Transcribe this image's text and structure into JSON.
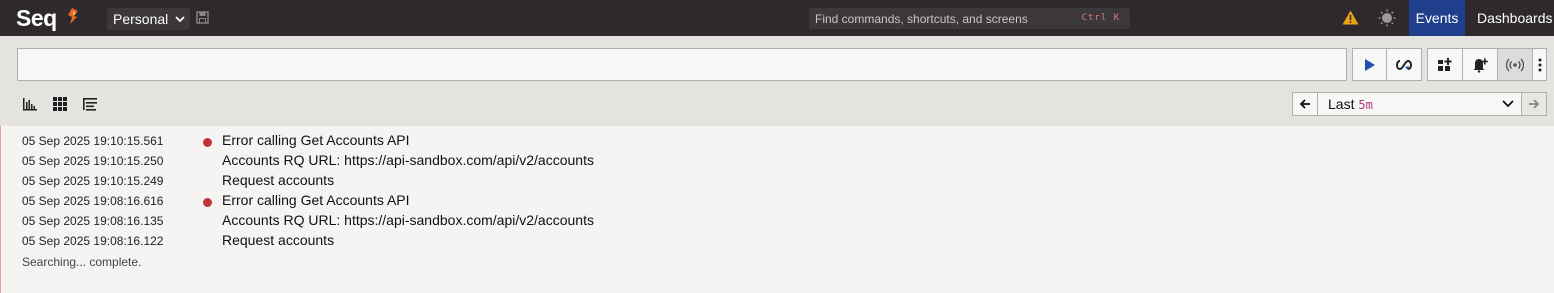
{
  "app": {
    "logo_text": "Seq",
    "workspace": "Personal",
    "command_placeholder": "Find commands, shortcuts, and screens",
    "command_shortcut": "Ctrl K"
  },
  "nav": {
    "events": "Events",
    "dashboards": "Dashboards"
  },
  "search": {
    "query": "",
    "time_range_label": "Last",
    "time_range_value": "5m"
  },
  "events": [
    {
      "timestamp": "05 Sep 2025  19:10:15.561",
      "level": "error",
      "message": "Error calling Get Accounts API"
    },
    {
      "timestamp": "05 Sep 2025  19:10:15.250",
      "level": "info",
      "message": "Accounts RQ URL: https://api-sandbox.com/api/v2/accounts"
    },
    {
      "timestamp": "05 Sep 2025  19:10:15.249",
      "level": "info",
      "message": "Request accounts"
    },
    {
      "timestamp": "05 Sep 2025  19:08:16.616",
      "level": "error",
      "message": "Error calling Get Accounts API"
    },
    {
      "timestamp": "05 Sep 2025  19:08:16.135",
      "level": "info",
      "message": "Accounts RQ URL: https://api-sandbox.com/api/v2/accounts"
    },
    {
      "timestamp": "05 Sep 2025  19:08:16.122",
      "level": "info",
      "message": "Request accounts"
    }
  ],
  "status_text": "Searching... complete.",
  "colors": {
    "topbar": "#2d292d",
    "events_nav_active": "#1f3f8c",
    "error_dot": "#c0333b",
    "warning": "#e8a317"
  }
}
